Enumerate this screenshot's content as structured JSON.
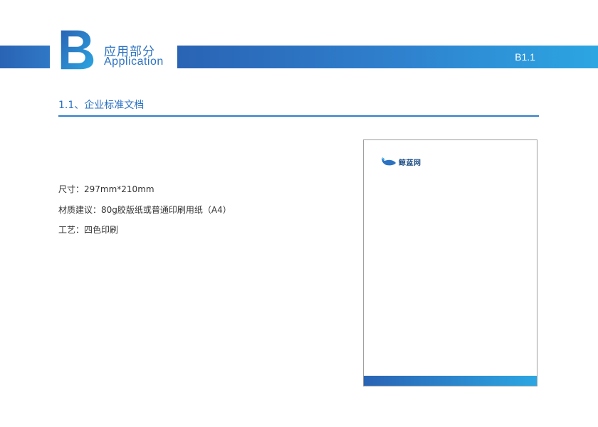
{
  "header": {
    "letter": "B",
    "title": "应用部分",
    "subtitle": "Application",
    "page_code": "B1.1",
    "accent_color": "#2c72c2"
  },
  "subsection": {
    "heading": "1.1、企业标准文档"
  },
  "specs": [
    "尺寸：297mm*210mm",
    "材质建议：80g胶版纸或普通印刷用纸（A4）",
    "工艺：四色印刷"
  ],
  "letterhead_preview": {
    "logo_icon": "whale-logo-icon",
    "logo_text": "鲸蓝网"
  }
}
